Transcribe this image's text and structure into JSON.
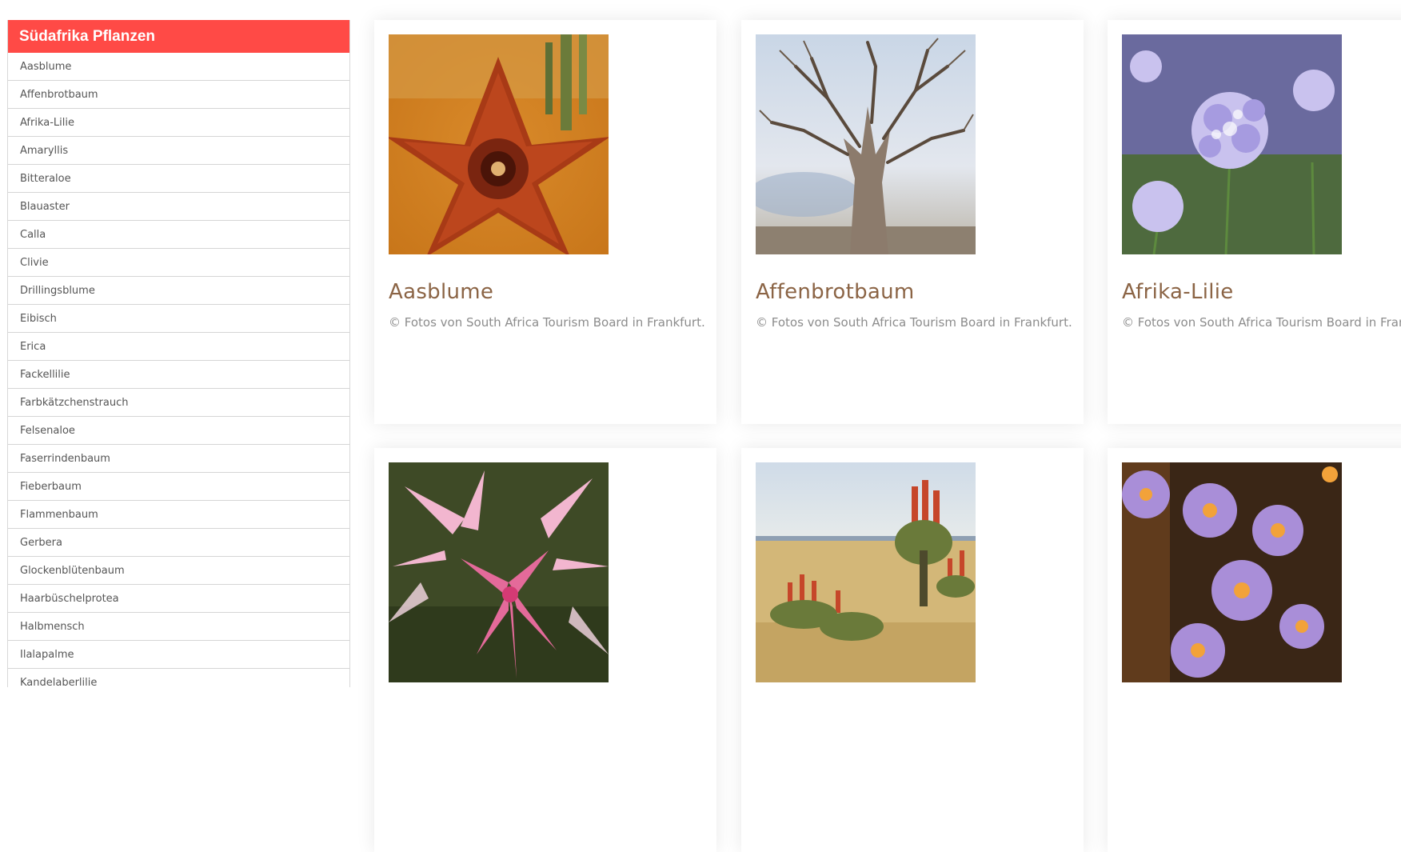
{
  "sidebar": {
    "title": "Südafrika Pflanzen",
    "items": [
      {
        "label": "Aasblume"
      },
      {
        "label": "Affenbrotbaum"
      },
      {
        "label": "Afrika-Lilie"
      },
      {
        "label": "Amaryllis"
      },
      {
        "label": "Bitteraloe"
      },
      {
        "label": "Blauaster"
      },
      {
        "label": "Calla"
      },
      {
        "label": "Clivie"
      },
      {
        "label": "Drillingsblume"
      },
      {
        "label": "Eibisch"
      },
      {
        "label": "Erica"
      },
      {
        "label": "Fackellilie"
      },
      {
        "label": "Farbkätzchenstrauch"
      },
      {
        "label": "Felsenaloe"
      },
      {
        "label": "Faserrindenbaum"
      },
      {
        "label": "Fieberbaum"
      },
      {
        "label": "Flammenbaum"
      },
      {
        "label": "Gerbera"
      },
      {
        "label": "Glockenblütenbaum"
      },
      {
        "label": "Haarbüschelprotea"
      },
      {
        "label": "Halbmensch"
      },
      {
        "label": "Ilalapalme"
      },
      {
        "label": "Kandelaberlilie"
      }
    ]
  },
  "cards": [
    {
      "title": "Aasblume",
      "caption": "© Fotos von South Africa Tourism Board in Frankfurt.",
      "image_icon": "carrion-flower-photo"
    },
    {
      "title": "Affenbrotbaum",
      "caption": "© Fotos von South Africa Tourism Board in Frankfurt.",
      "image_icon": "baobab-tree-photo"
    },
    {
      "title": "Afrika-Lilie",
      "caption": "© Fotos von South Africa Tourism Board in Frankfurt.",
      "image_icon": "agapanthus-photo"
    },
    {
      "title": "",
      "caption": "",
      "image_icon": "pink-lily-photo"
    },
    {
      "title": "",
      "caption": "",
      "image_icon": "aloe-landscape-photo"
    },
    {
      "title": "",
      "caption": "",
      "image_icon": "purple-aster-photo"
    }
  ],
  "colors": {
    "header_red": "#ff4a46",
    "title_brown": "#8b6445",
    "caption_gray": "#8c8c8c"
  }
}
